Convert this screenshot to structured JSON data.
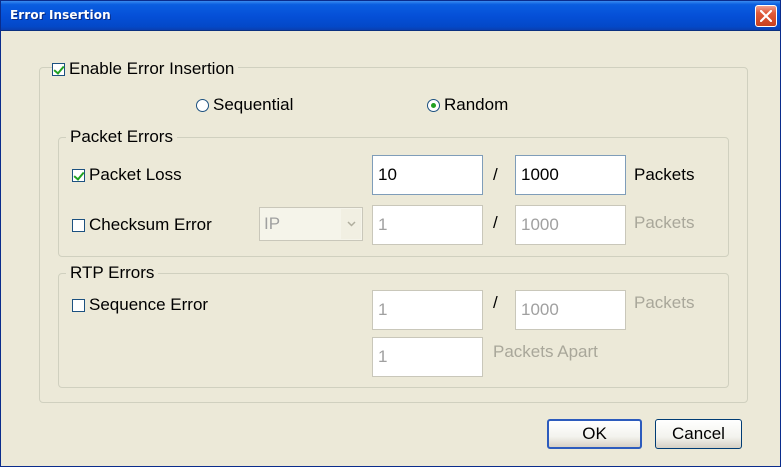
{
  "window": {
    "title": "Error Insertion"
  },
  "enable": {
    "label": "Enable Error Insertion",
    "checked": true
  },
  "mode": {
    "sequential_label": "Sequential",
    "random_label": "Random",
    "selected": "Random"
  },
  "packet_errors": {
    "legend": "Packet Errors",
    "packet_loss": {
      "label": "Packet Loss",
      "checked": true,
      "numerator": "10",
      "denominator": "1000",
      "unit": "Packets"
    },
    "checksum_error": {
      "label": "Checksum Error",
      "checked": false,
      "protocol": "IP",
      "numerator": "1",
      "denominator": "1000",
      "unit": "Packets"
    }
  },
  "rtp_errors": {
    "legend": "RTP Errors",
    "sequence_error": {
      "label": "Sequence Error",
      "checked": false,
      "numerator": "1",
      "denominator": "1000",
      "unit": "Packets",
      "apart_value": "1",
      "apart_label": "Packets Apart"
    }
  },
  "separator": "/",
  "buttons": {
    "ok": "OK",
    "cancel": "Cancel"
  },
  "colors": {
    "titlebar": "#0550d8",
    "dialog_bg": "#ece9d8",
    "check_mark": "#21a121",
    "disabled_text": "#a0a0a0"
  }
}
